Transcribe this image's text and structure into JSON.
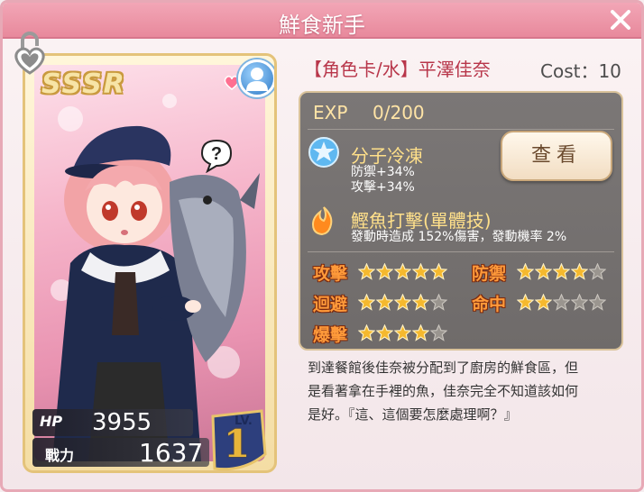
{
  "window": {
    "title": "鮮食新手"
  },
  "card": {
    "rarity": "SSSR",
    "hp_label": "HP",
    "hp": "3955",
    "power_label": "戰力",
    "power": "1637",
    "level_label": "LV.",
    "level": "1"
  },
  "info": {
    "name": "【角色卡/水】平澤佳奈",
    "cost": "Cost：10",
    "exp_label": "EXP",
    "exp_value": "0/200",
    "view_button": "查看",
    "skills": [
      {
        "name": "分子冷凍",
        "desc_lines": [
          "防禦+34%",
          "攻擊+34%"
        ],
        "icon": "blue-star-icon"
      },
      {
        "name": "鰹魚打擊(單體技)",
        "desc_lines": [
          "發動時造成 152%傷害，發動機率 2%"
        ],
        "icon": "fire-icon"
      }
    ],
    "stats": [
      {
        "label": "攻擊",
        "stars": 5
      },
      {
        "label": "防禦",
        "stars": 4
      },
      {
        "label": "迴避",
        "stars": 4
      },
      {
        "label": "命中",
        "stars": 2
      },
      {
        "label": "爆擊",
        "stars": 4
      }
    ],
    "stars_max": 5,
    "description_lines": [
      "到達餐館後佳奈被分配到了廚房的鮮食區，但",
      "是看著拿在手裡的魚，佳奈完全不知道該如何",
      "是好。『這、這個要怎麼處理啊？』"
    ]
  },
  "colors": {
    "title_bar": "#e8899c",
    "star_filled": "#f5b92e",
    "star_empty": "#9a958f",
    "stat_label": "#ff9a3a",
    "name": "#b8364a"
  }
}
